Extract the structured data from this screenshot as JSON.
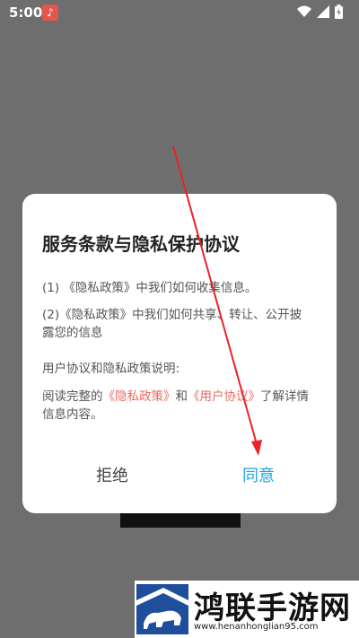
{
  "status_bar": {
    "time": "5:00"
  },
  "dialog": {
    "title": "服务条款与隐私保护协议",
    "item1": "(1) 《隐私政策》中我们如何收集信息。",
    "item2": "(2)《隐私政策》中我们如何共享、转让、公开披露您的信息",
    "note_label": "用户协议和隐私政策说明:",
    "note_prefix": "阅读完整的",
    "privacy_link": "《隐私政策》",
    "note_and": "和",
    "user_link": "《用户协议》",
    "note_suffix": "了解详情信息内容。",
    "reject_label": "拒绝",
    "agree_label": "同意"
  },
  "watermark": {
    "title": "鸿联手游网",
    "url": "www.henanhonglian95.com"
  },
  "colors": {
    "link": "#e56a5f",
    "agree": "#18a7e8",
    "arrow": "#e8222a"
  }
}
